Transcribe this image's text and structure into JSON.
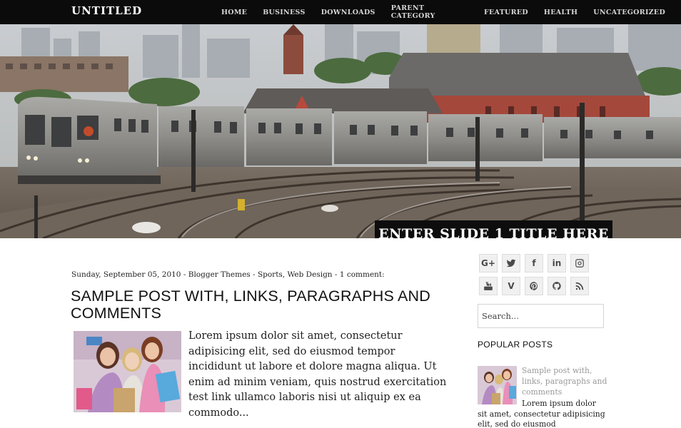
{
  "site": {
    "title": "UNTITLED"
  },
  "nav": {
    "items": [
      "HOME",
      "BUSINESS",
      "DOWNLOADS",
      "PARENT CATEGORY",
      "FEATURED",
      "HEALTH",
      "UNCATEGORIZED"
    ]
  },
  "slider": {
    "title": "ENTER SLIDE 1 TITLE HERE"
  },
  "post": {
    "date": "Sunday, September 05, 2010",
    "sep1": "-",
    "category": "Blogger Themes",
    "sep2": "-",
    "labels": "Sports, Web Design",
    "sep3": "-",
    "comments": "1 comment:",
    "title": "SAMPLE POST WITH, LINKS, PARAGRAPHS AND COMMENTS",
    "excerpt": "Lorem ipsum dolor sit amet, consectetur adipisicing elit, sed do eiusmod tempor incididunt ut labore et dolore magna aliqua. Ut enim ad minim veniam, quis nostrud exercitation test link ullamco laboris nisi ut aliquip ex ea commodo..."
  },
  "sidebar": {
    "social": [
      {
        "icon": "google-plus-icon",
        "glyph": "G+"
      },
      {
        "icon": "twitter-icon",
        "glyph": ""
      },
      {
        "icon": "facebook-icon",
        "glyph": "f"
      },
      {
        "icon": "linkedin-icon",
        "glyph": "in"
      },
      {
        "icon": "instagram-icon",
        "glyph": ""
      },
      {
        "icon": "youtube-icon",
        "glyph": ""
      },
      {
        "icon": "vimeo-icon",
        "glyph": "V"
      },
      {
        "icon": "pinterest-icon",
        "glyph": ""
      },
      {
        "icon": "github-icon",
        "glyph": ""
      },
      {
        "icon": "rss-icon",
        "glyph": ""
      }
    ],
    "search_placeholder": "Search...",
    "popular_heading": "POPULAR POSTS",
    "popular": {
      "title": "Sample post with, links, paragraphs and comments",
      "excerpt": "Lorem ipsum dolor sit amet, consectetur adipisicing elit, sed do eiusmod"
    }
  },
  "colors": {
    "topbar": "#0b0b0b",
    "slide_title_bg": "#0d0d0d",
    "link_muted": "#999999"
  }
}
